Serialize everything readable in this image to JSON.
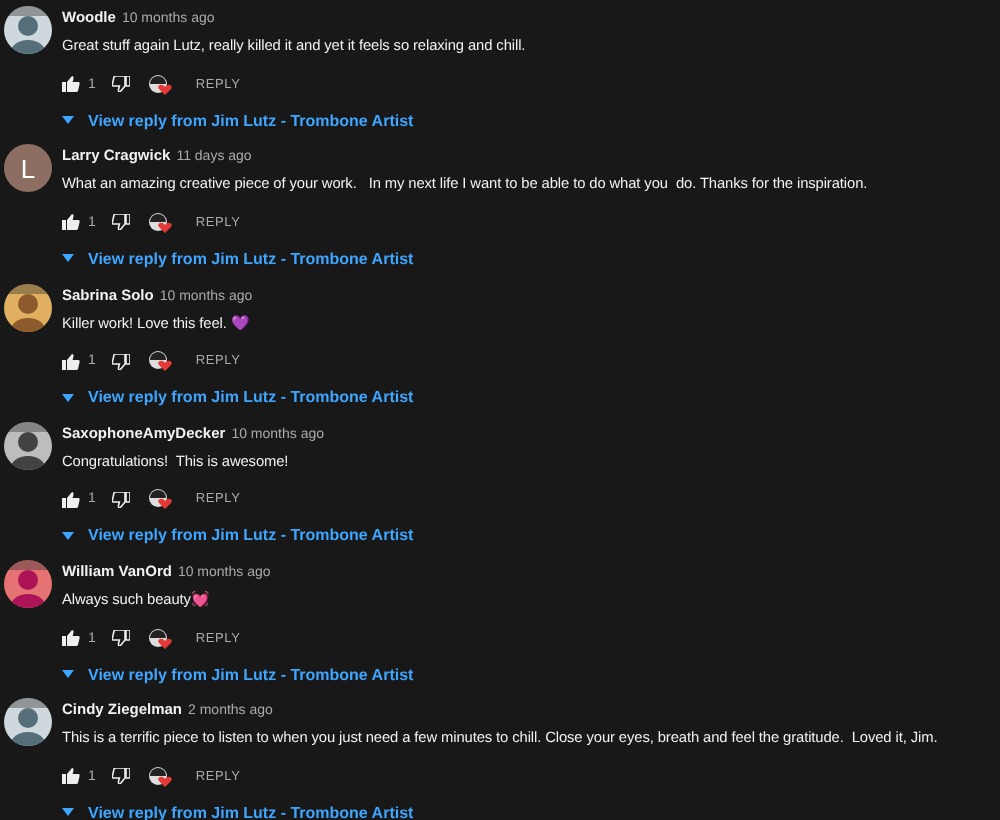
{
  "comments": [
    {
      "author": "Woodle",
      "time": "10 months ago",
      "text": "Great stuff again Lutz, really killed it and yet it feels so relaxing and chill.",
      "likes": "1",
      "reply": "REPLY",
      "view_replies": "View reply from Jim Lutz - Trombone Artist"
    },
    {
      "author": "Larry Cragwick",
      "time": "11 days ago",
      "avatar": {
        "kind": "letter",
        "letter": "L",
        "color": "#8d6e63"
      },
      "text": "What an amazing creative piece of your work.   In my next life I want to be able to do what you  do. Thanks for the inspiration.",
      "likes": "1",
      "reply": "REPLY",
      "view_replies": "View reply from Jim Lutz - Trombone Artist"
    },
    {
      "author": "Sabrina Solo",
      "time": "10 months ago",
      "text": "Killer work! Love this feel. 💜",
      "likes": "1",
      "reply": "REPLY",
      "view_replies": "View reply from Jim Lutz - Trombone Artist"
    },
    {
      "author": "SaxophoneAmyDecker",
      "time": "10 months ago",
      "text": "Congratulations!  This is awesome!",
      "likes": "1",
      "reply": "REPLY",
      "view_replies": "View reply from Jim Lutz - Trombone Artist"
    },
    {
      "author": "William VanOrd",
      "time": "10 months ago",
      "text": "Always such beauty💓",
      "likes": "1",
      "reply": "REPLY",
      "view_replies": "View reply from Jim Lutz - Trombone Artist"
    },
    {
      "author": "Cindy Ziegelman",
      "time": "2 months ago",
      "text": "This is a terrific piece to listen to when you just need a few minutes to chill. Close your eyes, breath and feel the gratitude.  Loved it, Jim.",
      "likes": "1",
      "reply": "REPLY",
      "view_replies": "View reply from Jim Lutz - Trombone Artist"
    }
  ]
}
